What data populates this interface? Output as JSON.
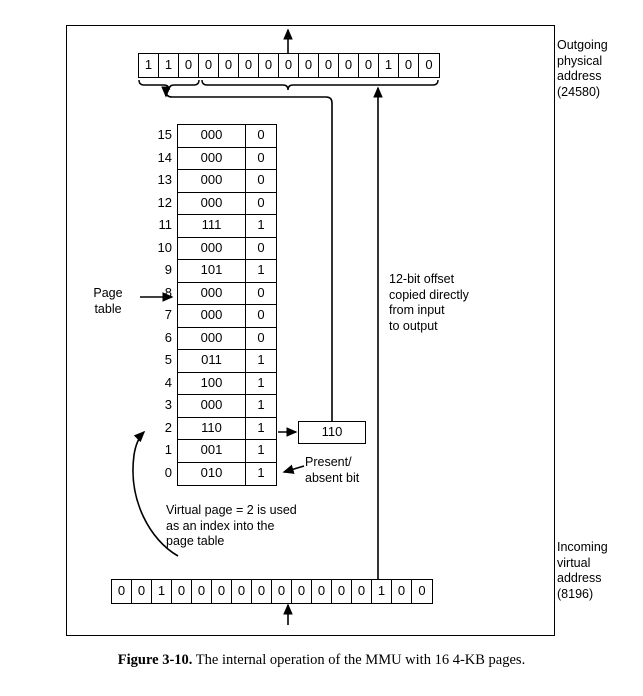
{
  "figure": {
    "caption_label": "Figure 3-10.",
    "caption_text": " The internal operation of the MMU with 16 4-KB pages."
  },
  "physical_address": {
    "name": "Outgoing physical address",
    "label": "Outgoing\nphysical\naddress\n(24580)",
    "value": 24580,
    "bits": [
      "1",
      "1",
      "0",
      "0",
      "0",
      "0",
      "0",
      "0",
      "0",
      "0",
      "0",
      "0",
      "1",
      "0",
      "0"
    ]
  },
  "virtual_address": {
    "name": "Incoming virtual address",
    "label": "Incoming\nvirtual\naddress\n(8196)",
    "value": 8196,
    "bits": [
      "0",
      "0",
      "1",
      "0",
      "0",
      "0",
      "0",
      "0",
      "0",
      "0",
      "0",
      "0",
      "0",
      "1",
      "0",
      "0"
    ]
  },
  "page_table": {
    "label": "Page\ntable",
    "index_header": "",
    "rows": [
      {
        "index": "15",
        "frame": "000",
        "present": "0"
      },
      {
        "index": "14",
        "frame": "000",
        "present": "0"
      },
      {
        "index": "13",
        "frame": "000",
        "present": "0"
      },
      {
        "index": "12",
        "frame": "000",
        "present": "0"
      },
      {
        "index": "11",
        "frame": "111",
        "present": "1"
      },
      {
        "index": "10",
        "frame": "000",
        "present": "0"
      },
      {
        "index": "9",
        "frame": "101",
        "present": "1"
      },
      {
        "index": "8",
        "frame": "000",
        "present": "0"
      },
      {
        "index": "7",
        "frame": "000",
        "present": "0"
      },
      {
        "index": "6",
        "frame": "000",
        "present": "0"
      },
      {
        "index": "5",
        "frame": "011",
        "present": "1"
      },
      {
        "index": "4",
        "frame": "100",
        "present": "1"
      },
      {
        "index": "3",
        "frame": "000",
        "present": "1"
      },
      {
        "index": "2",
        "frame": "110",
        "present": "1"
      },
      {
        "index": "1",
        "frame": "001",
        "present": "1"
      },
      {
        "index": "0",
        "frame": "010",
        "present": "1"
      }
    ]
  },
  "frame_value_box": {
    "value": "110"
  },
  "annotations": {
    "offset_note": "12-bit offset\ncopied directly\nfrom input\nto output",
    "present_bit_note": "Present/\nabsent bit",
    "index_note": "Virtual page = 2 is used\nas an index into the\npage table"
  },
  "colors": {
    "ink": "#000000",
    "background": "#ffffff"
  }
}
